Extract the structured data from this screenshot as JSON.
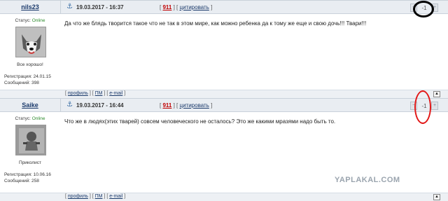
{
  "posts": [
    {
      "author": "nils23",
      "date": "19.03.2017 - 16:37",
      "post_number": "911",
      "cite_label": "цитировать",
      "status_label": "Статус:",
      "status_value": "Online",
      "avatar_caption": "Все хорошо!",
      "registration": "Регистрация: 24.01.15",
      "messages": "Сообщений: 398",
      "message": "Да что же блядь творится такое что не так в этом мире, как можно ребенка да к тому же еще и свою дочь!!! Твари!!!",
      "rating": "-1",
      "footer": {
        "profile": "профиль",
        "pm": "ПМ",
        "email": "e-mail"
      }
    },
    {
      "author": "Saike",
      "date": "19.03.2017 - 16:44",
      "post_number": "911",
      "cite_label": "цитировать",
      "status_label": "Статус:",
      "status_value": "Online",
      "avatar_caption": "Приколист",
      "registration": "Регистрация: 10.06.16",
      "messages": "Сообщений: 258",
      "message": "Что же в людях(этих тварей) совсем человеческого не осталось? Это же какими мразями надо быть то.",
      "rating": "-1",
      "footer": {
        "profile": "профиль",
        "pm": "ПМ",
        "email": "e-mail"
      }
    }
  ],
  "watermark": "YAPLAKAL.COM",
  "icons": {
    "anchor": "anchor-icon",
    "up": "scroll-up-icon",
    "rate_minus": "minus-icon",
    "rate_plus": "plus-icon"
  },
  "colors": {
    "highlight_black": "#000000",
    "highlight_red": "#e21616",
    "online": "#2e8b2e",
    "post_number": "#c00000"
  }
}
